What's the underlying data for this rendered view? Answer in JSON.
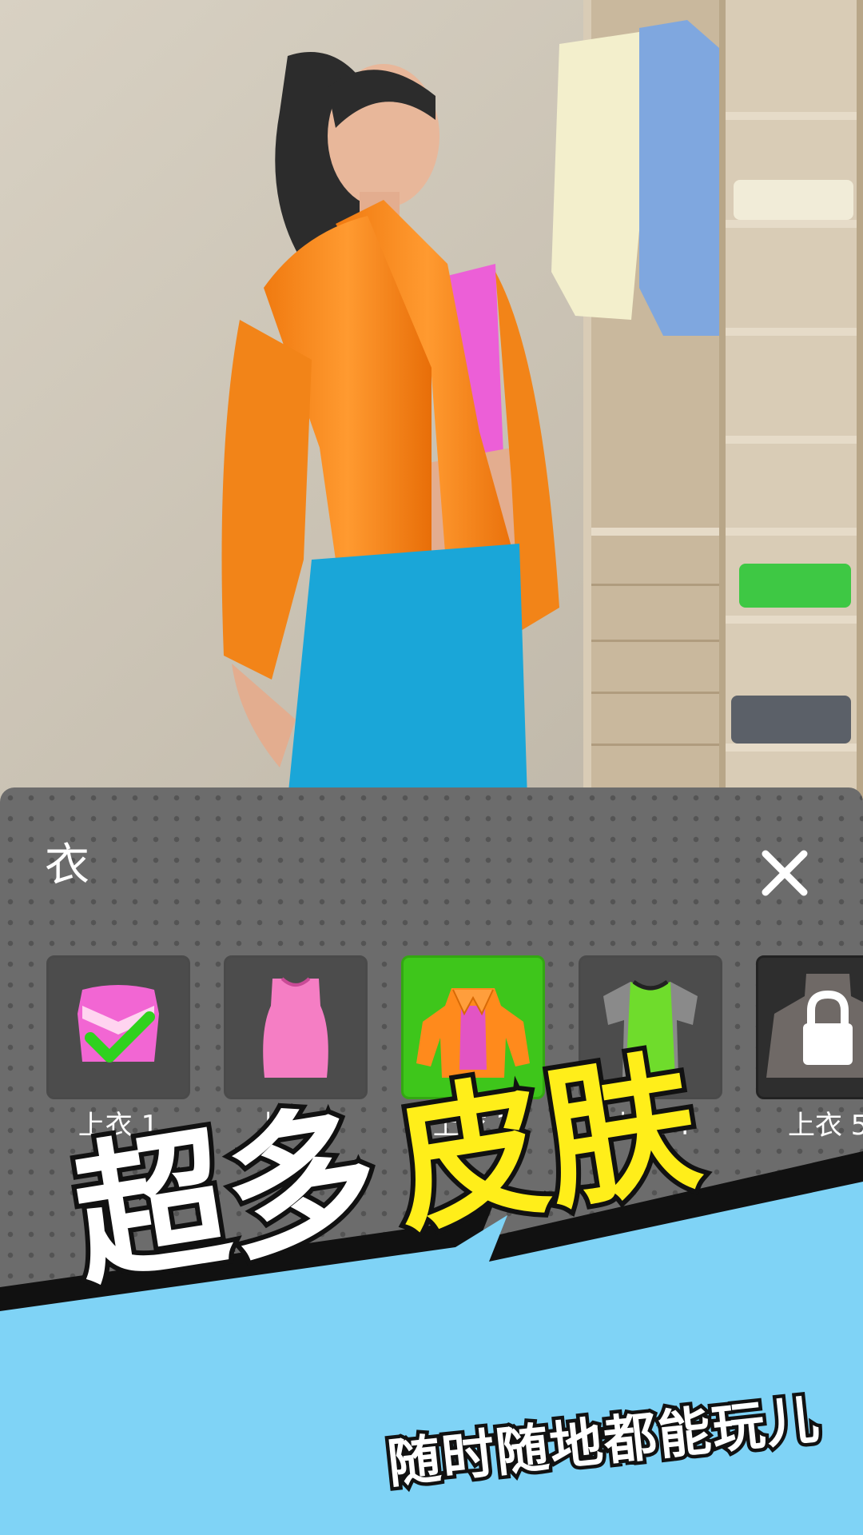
{
  "panel": {
    "title": "衣",
    "close_icon": "close-icon"
  },
  "items": [
    {
      "label": "上衣 1",
      "state": "equipped",
      "icon": "pink-crop-top-icon"
    },
    {
      "label": "上衣 2",
      "state": "normal",
      "icon": "pink-tank-top-icon"
    },
    {
      "label": "上衣 3",
      "state": "selected",
      "icon": "orange-puffer-jacket-icon"
    },
    {
      "label": "上衣 4",
      "state": "normal",
      "icon": "green-tshirt-icon"
    },
    {
      "label": "上衣 5",
      "state": "locked",
      "icon": "lock-icon"
    }
  ],
  "banner": {
    "headline_white": "超多",
    "headline_yellow": "皮肤",
    "subtitle": "随时随地都能玩儿"
  },
  "colors": {
    "selected_slot": "#3ec61b",
    "banner_blue": "#7fd3f6",
    "headline_yellow": "#ffee1a",
    "jacket_orange": "#ff8a1c",
    "jeans_blue": "#1aa6d8"
  }
}
